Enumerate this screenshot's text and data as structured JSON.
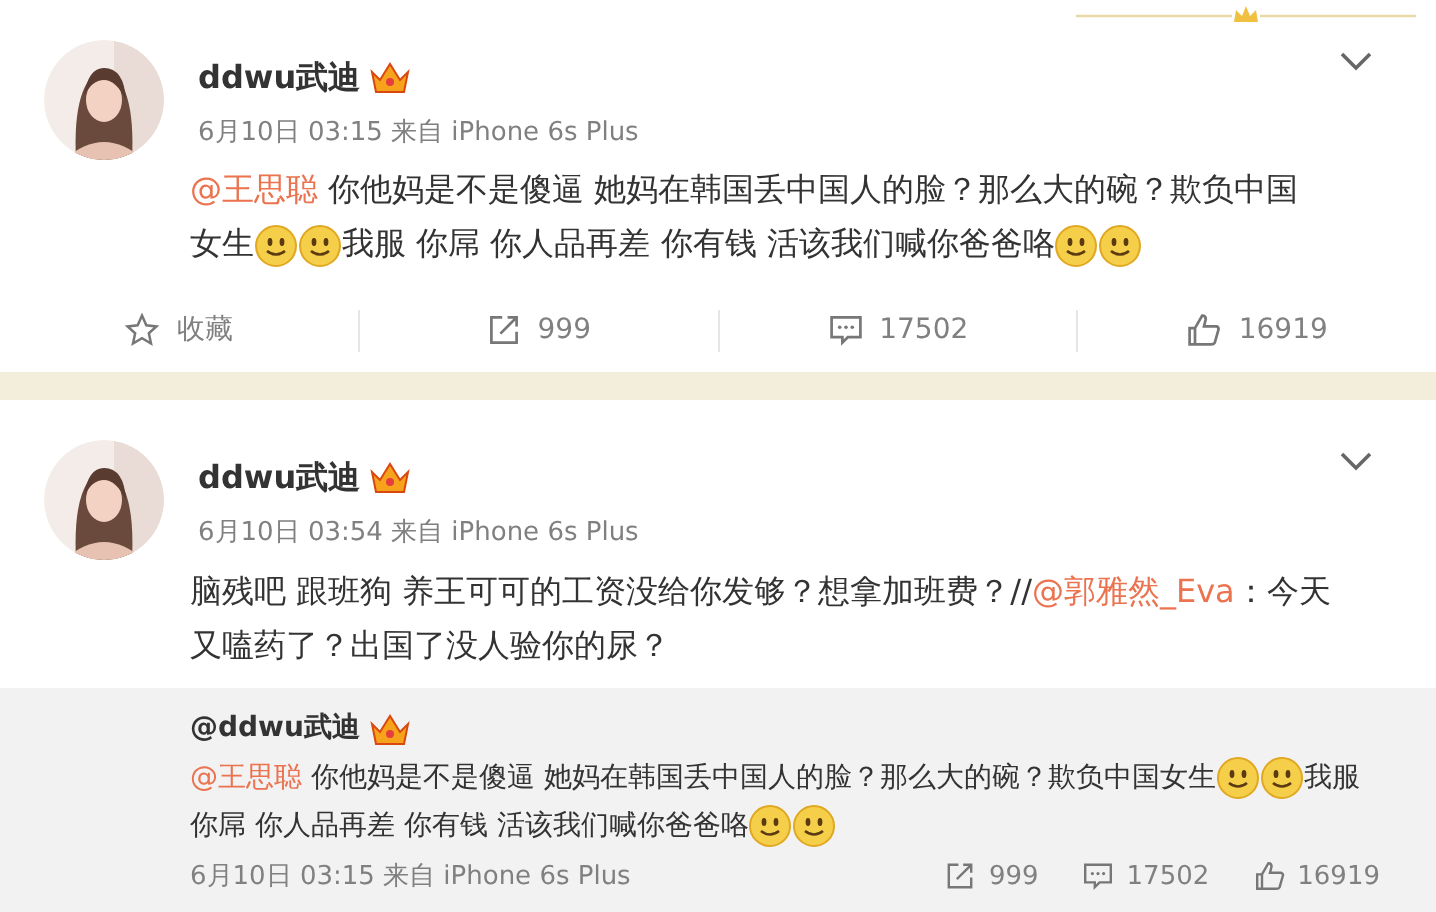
{
  "posts": [
    {
      "author": "ddwu武迪",
      "meta": "6月10日 03:15 来自 iPhone 6s Plus",
      "body": [
        {
          "kind": "mention",
          "text": "@王思聪"
        },
        {
          "kind": "text",
          "text": " 你他妈是不是傻逼 她妈在韩国丢中国人的脸？那么大的碗？欺负中国女生"
        },
        {
          "kind": "emoji"
        },
        {
          "kind": "emoji"
        },
        {
          "kind": "text",
          "text": "我服 你屌 你人品再差 你有钱 活该我们喊你爸爸咯"
        },
        {
          "kind": "emoji"
        },
        {
          "kind": "emoji"
        }
      ],
      "actions": [
        {
          "kind": "favorite",
          "label": "收藏"
        },
        {
          "kind": "repost",
          "label": "999"
        },
        {
          "kind": "comment",
          "label": "17502"
        },
        {
          "kind": "like",
          "label": "16919"
        }
      ]
    },
    {
      "author": "ddwu武迪",
      "meta": "6月10日 03:54 来自 iPhone 6s Plus",
      "body": [
        {
          "kind": "text",
          "text": "脑残吧 跟班狗 养王可可的工资没给你发够？想拿加班费？//"
        },
        {
          "kind": "mention",
          "text": "@郭雅然_Eva"
        },
        {
          "kind": "text",
          "text": "：今天又嗑药了？出国了没人验你的尿？"
        }
      ],
      "repost": {
        "author": "@ddwu武迪",
        "body": [
          {
            "kind": "mention",
            "text": "@王思聪"
          },
          {
            "kind": "text",
            "text": " 你他妈是不是傻逼 她妈在韩国丢中国人的脸？那么大的碗？欺负中国女生"
          },
          {
            "kind": "emoji"
          },
          {
            "kind": "emoji"
          },
          {
            "kind": "text",
            "text": "我服你屌 你人品再差 你有钱 活该我们喊你爸爸咯"
          },
          {
            "kind": "emoji"
          },
          {
            "kind": "emoji"
          }
        ],
        "meta": "6月10日 03:15 来自 iPhone 6s Plus",
        "actions": [
          {
            "kind": "repost",
            "label": "999"
          },
          {
            "kind": "comment",
            "label": "17502"
          },
          {
            "kind": "like",
            "label": "16919"
          }
        ]
      }
    }
  ]
}
